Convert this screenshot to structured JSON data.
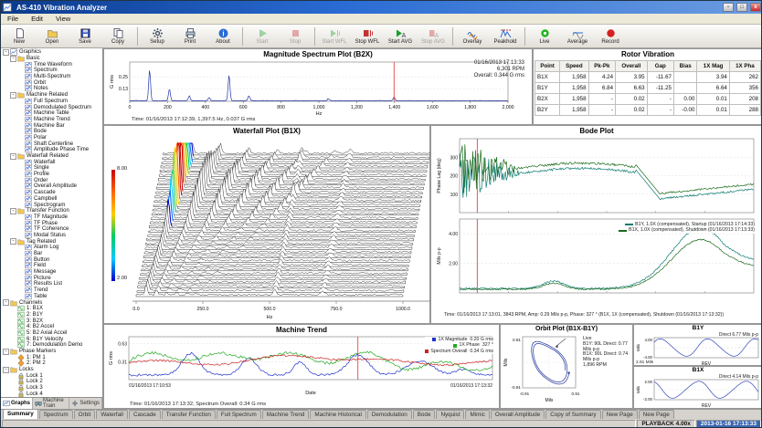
{
  "window": {
    "title": "AS-410 Vibration Analyzer",
    "min": "-",
    "max": "□",
    "close": "x"
  },
  "menu": [
    "File",
    "Edit",
    "View"
  ],
  "toolbar": [
    {
      "label": "New",
      "icon": "new-page",
      "enabled": true,
      "group_start": true
    },
    {
      "label": "Open",
      "icon": "open-folder",
      "enabled": true
    },
    {
      "label": "Save",
      "icon": "save",
      "enabled": true
    },
    {
      "label": "Copy",
      "icon": "copy",
      "enabled": true
    },
    {
      "label": "Setup",
      "icon": "setup",
      "enabled": true,
      "group_start": true
    },
    {
      "label": "Print",
      "icon": "print",
      "enabled": true
    },
    {
      "label": "About",
      "icon": "about",
      "enabled": true
    },
    {
      "label": "Start",
      "icon": "start",
      "enabled": false,
      "group_start": true
    },
    {
      "label": "Stop",
      "icon": "stop",
      "enabled": false
    },
    {
      "label": "Start WFL",
      "icon": "start-wfl",
      "enabled": false,
      "group_start": true
    },
    {
      "label": "Stop WFL",
      "icon": "stop-wfl",
      "enabled": true
    },
    {
      "label": "Start AVG",
      "icon": "start-avg",
      "enabled": true
    },
    {
      "label": "Stop AVG",
      "icon": "stop-avg",
      "enabled": false
    },
    {
      "label": "Overlay",
      "icon": "overlay",
      "enabled": true,
      "group_start": true
    },
    {
      "label": "Peakhold",
      "icon": "peakhold",
      "enabled": true
    },
    {
      "label": "Live",
      "icon": "live",
      "enabled": true,
      "group_start": true
    },
    {
      "label": "Average",
      "icon": "average",
      "enabled": true
    },
    {
      "label": "Record",
      "icon": "record",
      "enabled": true
    }
  ],
  "sidebar": {
    "tree": [
      {
        "label": "Graphics",
        "depth": 0,
        "icon": "chart",
        "expand": true
      },
      {
        "label": "Basic",
        "depth": 1,
        "icon": "folder",
        "expand": true
      },
      {
        "label": "Time Waveform",
        "depth": 2,
        "icon": "plot"
      },
      {
        "label": "Spectrum",
        "depth": 2,
        "icon": "plot"
      },
      {
        "label": "Multi-Spectrum",
        "depth": 2,
        "icon": "plot"
      },
      {
        "label": "Orbit",
        "depth": 2,
        "icon": "plot"
      },
      {
        "label": "Notes",
        "depth": 2,
        "icon": "plot"
      },
      {
        "label": "Machine Related",
        "depth": 1,
        "icon": "folder",
        "expand": true
      },
      {
        "label": "Full Spectrum",
        "depth": 2,
        "icon": "plot"
      },
      {
        "label": "Demodulated Spectrum",
        "depth": 2,
        "icon": "plot"
      },
      {
        "label": "Machine Table",
        "depth": 2,
        "icon": "plot"
      },
      {
        "label": "Machine Trend",
        "depth": 2,
        "icon": "plot"
      },
      {
        "label": "Machine Bar",
        "depth": 2,
        "icon": "plot"
      },
      {
        "label": "Bode",
        "depth": 2,
        "icon": "plot"
      },
      {
        "label": "Polar",
        "depth": 2,
        "icon": "plot"
      },
      {
        "label": "Shaft Centerline",
        "depth": 2,
        "icon": "plot"
      },
      {
        "label": "Amplitude Phase Time",
        "depth": 2,
        "icon": "plot"
      },
      {
        "label": "Waterfall Related",
        "depth": 1,
        "icon": "folder",
        "expand": true
      },
      {
        "label": "Waterfall",
        "depth": 2,
        "icon": "plot"
      },
      {
        "label": "Single",
        "depth": 2,
        "icon": "plot"
      },
      {
        "label": "Profile",
        "depth": 2,
        "icon": "plot"
      },
      {
        "label": "Order",
        "depth": 2,
        "icon": "plot"
      },
      {
        "label": "Overall Amplitude",
        "depth": 2,
        "icon": "plot"
      },
      {
        "label": "Cascade",
        "depth": 2,
        "icon": "plot"
      },
      {
        "label": "Campbell",
        "depth": 2,
        "icon": "plot"
      },
      {
        "label": "Spectrogram",
        "depth": 2,
        "icon": "plot"
      },
      {
        "label": "Transfer Function",
        "depth": 1,
        "icon": "folder",
        "expand": true
      },
      {
        "label": "TF Magnitude",
        "depth": 2,
        "icon": "plot"
      },
      {
        "label": "TF Phase",
        "depth": 2,
        "icon": "plot"
      },
      {
        "label": "TF Coherence",
        "depth": 2,
        "icon": "plot"
      },
      {
        "label": "Modal Status",
        "depth": 2,
        "icon": "plot"
      },
      {
        "label": "Tag Related",
        "depth": 1,
        "icon": "folder",
        "expand": true
      },
      {
        "label": "Alarm Log",
        "depth": 2,
        "icon": "plot"
      },
      {
        "label": "Bar",
        "depth": 2,
        "icon": "plot"
      },
      {
        "label": "Button",
        "depth": 2,
        "icon": "plot"
      },
      {
        "label": "Field",
        "depth": 2,
        "icon": "plot"
      },
      {
        "label": "Message",
        "depth": 2,
        "icon": "plot"
      },
      {
        "label": "Picture",
        "depth": 2,
        "icon": "plot"
      },
      {
        "label": "Results List",
        "depth": 2,
        "icon": "plot"
      },
      {
        "label": "Trend",
        "depth": 2,
        "icon": "plot"
      },
      {
        "label": "Table",
        "depth": 2,
        "icon": "plot"
      },
      {
        "label": "Channels",
        "depth": 0,
        "icon": "folder",
        "expand": true
      },
      {
        "label": "1: B1X",
        "depth": 1,
        "icon": "channel"
      },
      {
        "label": "2: B1Y",
        "depth": 1,
        "icon": "channel"
      },
      {
        "label": "3: B2X",
        "depth": 1,
        "icon": "channel"
      },
      {
        "label": "4: B2 Accel",
        "depth": 1,
        "icon": "channel"
      },
      {
        "label": "5: B2 Axial Accel",
        "depth": 1,
        "icon": "channel"
      },
      {
        "label": "6: B1Y Velocity",
        "depth": 1,
        "icon": "channel"
      },
      {
        "label": "7: Demodulation Demo",
        "depth": 1,
        "icon": "channel"
      },
      {
        "label": "Phase Markers",
        "depth": 0,
        "icon": "folder",
        "expand": true
      },
      {
        "label": "1: PM 1",
        "depth": 1,
        "icon": "marker"
      },
      {
        "label": "2: PM 2",
        "depth": 1,
        "icon": "marker"
      },
      {
        "label": "Locks",
        "depth": 0,
        "icon": "folder",
        "expand": true
      },
      {
        "label": "Lock 1",
        "depth": 1,
        "icon": "lock"
      },
      {
        "label": "Lock 2",
        "depth": 1,
        "icon": "lock"
      },
      {
        "label": "Lock 3",
        "depth": 1,
        "icon": "lock"
      },
      {
        "label": "Lock 4",
        "depth": 1,
        "icon": "lock"
      }
    ],
    "tabs": [
      {
        "label": "Graphs",
        "icon": "graphs",
        "active": true
      },
      {
        "label": "Machine Train",
        "icon": "machine-train",
        "active": false
      },
      {
        "label": "Settings",
        "icon": "settings",
        "active": false
      }
    ]
  },
  "rotor_table": {
    "title": "Rotor Vibration",
    "columns": [
      "Point",
      "Speed",
      "Pk-Pk",
      "Overall",
      "Gap",
      "Bias",
      "1X Mag",
      "1X Pha"
    ],
    "rows": [
      [
        "B1X",
        "1,958",
        "4.24",
        "3.95",
        "-11.67",
        "",
        "3.94",
        "262"
      ],
      [
        "B1Y",
        "1,958",
        "6.84",
        "6.63",
        "-11.25",
        "",
        "6.64",
        "356"
      ],
      [
        "B2X",
        "1,958",
        "-",
        "0.02",
        "-",
        "0.00",
        "0.01",
        "208"
      ],
      [
        "B2Y",
        "1,958",
        "-",
        "0.02",
        "-",
        "-0.00",
        "0.01",
        "288"
      ]
    ]
  },
  "chart_data": [
    {
      "id": "spectrum",
      "type": "line",
      "title": "Magnitude Spectrum Plot (B2X)",
      "annotations": [
        "01/16/2013 17:13:33",
        "6,301 RPM",
        "Overall: 0.344 G rms"
      ],
      "ylabel": "G rms",
      "ylim": [
        0,
        0.4
      ],
      "yticks": [
        {
          "v": 0.25,
          "label": "0.25"
        },
        {
          "v": 0.13,
          "label": "0.13"
        }
      ],
      "xlabel": "Hz",
      "xlim": [
        0,
        2000
      ],
      "xticks": [
        {
          "v": 0,
          "label": "0"
        },
        {
          "v": 200,
          "label": "200"
        },
        {
          "v": 400,
          "label": "400"
        },
        {
          "v": 600,
          "label": "600"
        },
        {
          "v": 800,
          "label": "800"
        },
        {
          "v": 1000,
          "label": "1,000"
        },
        {
          "v": 1200,
          "label": "1,200"
        },
        {
          "v": 1400,
          "label": "1,400"
        },
        {
          "v": 1600,
          "label": "1,600"
        },
        {
          "v": 1800,
          "label": "1,800"
        },
        {
          "v": 2000,
          "label": "2,000"
        }
      ],
      "peaks_hz_amp": [
        [
          105,
          0.31
        ],
        [
          210,
          0.12
        ],
        [
          315,
          0.05
        ],
        [
          420,
          0.03
        ],
        [
          525,
          0.26
        ],
        [
          630,
          0.05
        ],
        [
          1050,
          0.02
        ],
        [
          1397.5,
          0.037
        ]
      ],
      "cursor_hz": 1397.5,
      "line_color": "#2233aa",
      "cursor_color": "#e03030",
      "footer": "Time: 01/16/2013 17:12:39, 1,397.5 Hz, 0.037 G rms"
    },
    {
      "id": "waterfall",
      "type": "waterfall",
      "title": "Waterfall Plot (B1X)",
      "xlabel": "Hz",
      "xticks": [
        {
          "v": 0,
          "label": "0.0"
        },
        {
          "v": 250,
          "label": "250.0"
        },
        {
          "v": 500,
          "label": "500.0"
        },
        {
          "v": 750,
          "label": "750.0"
        },
        {
          "v": 1000,
          "label": "1000.0"
        }
      ],
      "left_labels": [
        "8.00",
        "2.00"
      ],
      "num_traces": 34,
      "palette": [
        "#0000cc",
        "#0066ff",
        "#00ccff",
        "#00cc66",
        "#99cc00",
        "#ffcc00",
        "#ff6600",
        "#cc0000"
      ]
    },
    {
      "id": "bode",
      "type": "bode",
      "title": "Bode Plot",
      "phase": {
        "ylabel": "Phase Lag (deg)",
        "ylim": [
          0,
          400
        ],
        "yticks": [
          {
            "v": 300,
            "label": "300"
          },
          {
            "v": 200,
            "label": "200"
          },
          {
            "v": 100,
            "label": "100"
          }
        ]
      },
      "amp": {
        "ylabel": "Mils p-p",
        "ylim": [
          0,
          5
        ],
        "yticks": [
          {
            "v": 4,
            "label": "4.00"
          },
          {
            "v": 2,
            "label": "2.00"
          }
        ]
      },
      "legend": [
        {
          "color": "#0b7a70",
          "label": "B1Y, 1.0X (compensated), Startup (01/16/2013 17:14:33)"
        },
        {
          "color": "#1a6b1a",
          "label": "B1X, 1.0X (compensated), Shutdown (01/16/2013 17:13:33)"
        }
      ],
      "cursor_frac": 0.06,
      "cursor_color": "#e03030",
      "footer": "Time: 01/16/2013 17:13:01, 3843 RPM, Amp: 0.29 Mils p-p, Phase: 327 ° (B1X, 1X (compensated), Shutdown (01/16/2013 17:13:32))"
    },
    {
      "id": "trend",
      "type": "trend",
      "title": "Machine Trend",
      "legend": [
        {
          "color": "#2233cc",
          "label": "1X Magnitude",
          "value": "0.20 G rms"
        },
        {
          "color": "#22aa22",
          "label": "1X Phase",
          "value": "327 °"
        },
        {
          "color": "#cc2222",
          "label": "Spectrum Overall",
          "value": "0.34 G rms"
        }
      ],
      "ylabel": "G rms",
      "ylim": [
        0,
        0.75
      ],
      "yticks": [
        {
          "v": 0.63,
          "label": "0.63"
        },
        {
          "v": 0.31,
          "label": "0.31"
        }
      ],
      "xlabel": "Date",
      "x_start": "01/16/2013 17:10:53",
      "x_end": "01/16/2013 17:13:32",
      "cursor_frac": 0.63,
      "cursor_color": "#e03030",
      "footer": "Time: 01/16/2013 17:13:32, Spectrum Overall: 0.34 G rms"
    },
    {
      "id": "orbit",
      "type": "orbit",
      "title": "Orbit Plot (B1X-B1Y)",
      "annotations": [
        "Live",
        "B1Y: 90L Direct: 0.77 Mils p-p",
        "B1X: 90L Direct: 0.74 Mils p-p",
        "1,896 RPM"
      ],
      "xlabel": "Mils",
      "ylabel": "Mils",
      "yticks": [
        {
          "v": 0.91,
          "label": "0.91"
        },
        {
          "v": -0.91,
          "label": "-0.91"
        }
      ],
      "xticks": [
        {
          "v": -0.91,
          "label": "-0.91"
        },
        {
          "v": 0.91,
          "label": "0.91"
        }
      ],
      "line_color": "#223399"
    },
    {
      "id": "wave-b1y",
      "type": "waveform",
      "title": "B1Y",
      "annotation": "Direct 6.77 Mils p-p",
      "ylabel": "Mils",
      "ylim": [
        -4,
        4
      ],
      "yticks": [
        {
          "v": 4,
          "label": "4.00"
        },
        {
          "v": -4,
          "label": "-4.00"
        }
      ],
      "xlabel": "REV",
      "amplitude_pp": 6.77,
      "cycles": 2.2,
      "phase": 0.6,
      "footer": "2.91 Mils",
      "line_color": "#3344bb"
    },
    {
      "id": "wave-b1x",
      "type": "waveform",
      "title": "B1X",
      "annotation": "Direct 4.14 Mils p-p",
      "ylabel": "Mils",
      "ylim": [
        -2.5,
        2.5
      ],
      "yticks": [
        {
          "v": 2,
          "label": "2.00"
        },
        {
          "v": -2,
          "label": "-2.00"
        }
      ],
      "xlabel": "REV",
      "amplitude_pp": 4.14,
      "cycles": 2.2,
      "phase": 2.1,
      "footer": "",
      "line_color": "#3344bb"
    }
  ],
  "bottom_tabs": {
    "active": 0,
    "labels": [
      "Summary",
      "Spectrum",
      "Orbit",
      "Waterfall",
      "Cascade",
      "Transfer Function",
      "Full Spectrum",
      "Machine Trend",
      "Machine Historical",
      "Demodulation",
      "Bode",
      "Nyquist",
      "Mimic",
      "Overall Amplitude",
      "Copy of Summary",
      "New Page",
      "New Page"
    ]
  },
  "statusbar": {
    "message": "",
    "playback": "PLAYBACK 4.00x",
    "clock": "2013-01-16 17:13:33"
  }
}
